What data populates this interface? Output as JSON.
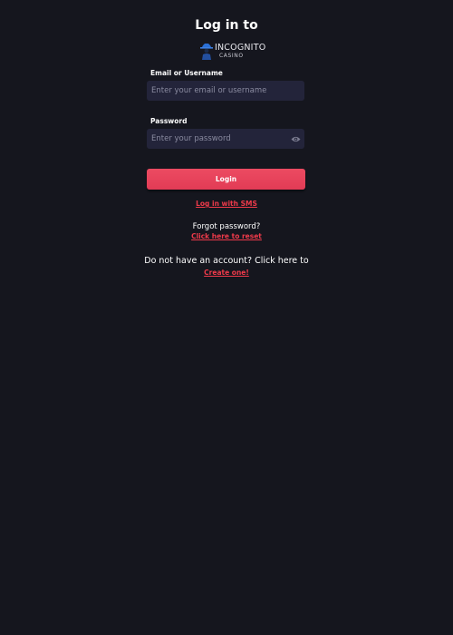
{
  "header": {
    "title": "Log in to"
  },
  "logo": {
    "name": "INCOGNITO",
    "subtitle": "CASINO",
    "icon": "incognito-figure-icon"
  },
  "form": {
    "email_label": "Email or Username",
    "email_placeholder": "Enter your email or username",
    "email_value": "",
    "password_label": "Password",
    "password_placeholder": "Enter your password",
    "password_value": "",
    "password_toggle_icon": "eye-icon",
    "login_label": "Login"
  },
  "links": {
    "sms_login": "Log in with SMS",
    "forgot_text": "Forgot password?",
    "reset_link": "Click here to reset",
    "signup_text": "Do not have an account? Click here to",
    "signup_link": "Create one!"
  },
  "colors": {
    "background": "#15161e",
    "input_background": "#23243a",
    "accent": "#e84157",
    "link": "#ee3a4a"
  }
}
